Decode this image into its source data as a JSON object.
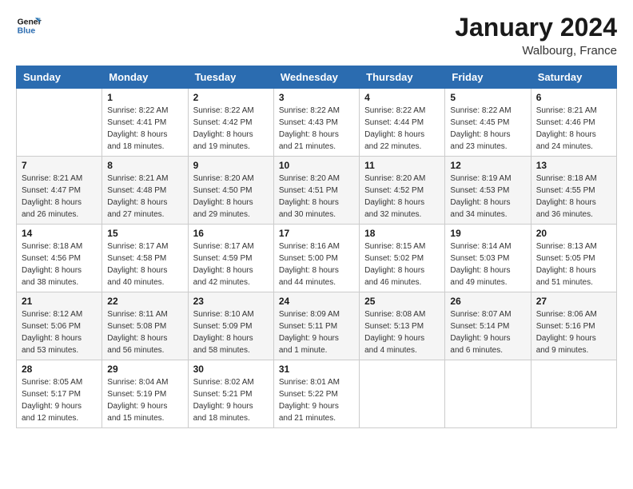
{
  "logo": {
    "line1": "General",
    "line2": "Blue",
    "icon_color": "#2b6cb0"
  },
  "title": "January 2024",
  "location": "Walbourg, France",
  "days_of_week": [
    "Sunday",
    "Monday",
    "Tuesday",
    "Wednesday",
    "Thursday",
    "Friday",
    "Saturday"
  ],
  "weeks": [
    [
      {
        "day": "",
        "sunrise": "",
        "sunset": "",
        "daylight": ""
      },
      {
        "day": "1",
        "sunrise": "Sunrise: 8:22 AM",
        "sunset": "Sunset: 4:41 PM",
        "daylight": "Daylight: 8 hours and 18 minutes."
      },
      {
        "day": "2",
        "sunrise": "Sunrise: 8:22 AM",
        "sunset": "Sunset: 4:42 PM",
        "daylight": "Daylight: 8 hours and 19 minutes."
      },
      {
        "day": "3",
        "sunrise": "Sunrise: 8:22 AM",
        "sunset": "Sunset: 4:43 PM",
        "daylight": "Daylight: 8 hours and 21 minutes."
      },
      {
        "day": "4",
        "sunrise": "Sunrise: 8:22 AM",
        "sunset": "Sunset: 4:44 PM",
        "daylight": "Daylight: 8 hours and 22 minutes."
      },
      {
        "day": "5",
        "sunrise": "Sunrise: 8:22 AM",
        "sunset": "Sunset: 4:45 PM",
        "daylight": "Daylight: 8 hours and 23 minutes."
      },
      {
        "day": "6",
        "sunrise": "Sunrise: 8:21 AM",
        "sunset": "Sunset: 4:46 PM",
        "daylight": "Daylight: 8 hours and 24 minutes."
      }
    ],
    [
      {
        "day": "7",
        "sunrise": "Sunrise: 8:21 AM",
        "sunset": "Sunset: 4:47 PM",
        "daylight": "Daylight: 8 hours and 26 minutes."
      },
      {
        "day": "8",
        "sunrise": "Sunrise: 8:21 AM",
        "sunset": "Sunset: 4:48 PM",
        "daylight": "Daylight: 8 hours and 27 minutes."
      },
      {
        "day": "9",
        "sunrise": "Sunrise: 8:20 AM",
        "sunset": "Sunset: 4:50 PM",
        "daylight": "Daylight: 8 hours and 29 minutes."
      },
      {
        "day": "10",
        "sunrise": "Sunrise: 8:20 AM",
        "sunset": "Sunset: 4:51 PM",
        "daylight": "Daylight: 8 hours and 30 minutes."
      },
      {
        "day": "11",
        "sunrise": "Sunrise: 8:20 AM",
        "sunset": "Sunset: 4:52 PM",
        "daylight": "Daylight: 8 hours and 32 minutes."
      },
      {
        "day": "12",
        "sunrise": "Sunrise: 8:19 AM",
        "sunset": "Sunset: 4:53 PM",
        "daylight": "Daylight: 8 hours and 34 minutes."
      },
      {
        "day": "13",
        "sunrise": "Sunrise: 8:18 AM",
        "sunset": "Sunset: 4:55 PM",
        "daylight": "Daylight: 8 hours and 36 minutes."
      }
    ],
    [
      {
        "day": "14",
        "sunrise": "Sunrise: 8:18 AM",
        "sunset": "Sunset: 4:56 PM",
        "daylight": "Daylight: 8 hours and 38 minutes."
      },
      {
        "day": "15",
        "sunrise": "Sunrise: 8:17 AM",
        "sunset": "Sunset: 4:58 PM",
        "daylight": "Daylight: 8 hours and 40 minutes."
      },
      {
        "day": "16",
        "sunrise": "Sunrise: 8:17 AM",
        "sunset": "Sunset: 4:59 PM",
        "daylight": "Daylight: 8 hours and 42 minutes."
      },
      {
        "day": "17",
        "sunrise": "Sunrise: 8:16 AM",
        "sunset": "Sunset: 5:00 PM",
        "daylight": "Daylight: 8 hours and 44 minutes."
      },
      {
        "day": "18",
        "sunrise": "Sunrise: 8:15 AM",
        "sunset": "Sunset: 5:02 PM",
        "daylight": "Daylight: 8 hours and 46 minutes."
      },
      {
        "day": "19",
        "sunrise": "Sunrise: 8:14 AM",
        "sunset": "Sunset: 5:03 PM",
        "daylight": "Daylight: 8 hours and 49 minutes."
      },
      {
        "day": "20",
        "sunrise": "Sunrise: 8:13 AM",
        "sunset": "Sunset: 5:05 PM",
        "daylight": "Daylight: 8 hours and 51 minutes."
      }
    ],
    [
      {
        "day": "21",
        "sunrise": "Sunrise: 8:12 AM",
        "sunset": "Sunset: 5:06 PM",
        "daylight": "Daylight: 8 hours and 53 minutes."
      },
      {
        "day": "22",
        "sunrise": "Sunrise: 8:11 AM",
        "sunset": "Sunset: 5:08 PM",
        "daylight": "Daylight: 8 hours and 56 minutes."
      },
      {
        "day": "23",
        "sunrise": "Sunrise: 8:10 AM",
        "sunset": "Sunset: 5:09 PM",
        "daylight": "Daylight: 8 hours and 58 minutes."
      },
      {
        "day": "24",
        "sunrise": "Sunrise: 8:09 AM",
        "sunset": "Sunset: 5:11 PM",
        "daylight": "Daylight: 9 hours and 1 minute."
      },
      {
        "day": "25",
        "sunrise": "Sunrise: 8:08 AM",
        "sunset": "Sunset: 5:13 PM",
        "daylight": "Daylight: 9 hours and 4 minutes."
      },
      {
        "day": "26",
        "sunrise": "Sunrise: 8:07 AM",
        "sunset": "Sunset: 5:14 PM",
        "daylight": "Daylight: 9 hours and 6 minutes."
      },
      {
        "day": "27",
        "sunrise": "Sunrise: 8:06 AM",
        "sunset": "Sunset: 5:16 PM",
        "daylight": "Daylight: 9 hours and 9 minutes."
      }
    ],
    [
      {
        "day": "28",
        "sunrise": "Sunrise: 8:05 AM",
        "sunset": "Sunset: 5:17 PM",
        "daylight": "Daylight: 9 hours and 12 minutes."
      },
      {
        "day": "29",
        "sunrise": "Sunrise: 8:04 AM",
        "sunset": "Sunset: 5:19 PM",
        "daylight": "Daylight: 9 hours and 15 minutes."
      },
      {
        "day": "30",
        "sunrise": "Sunrise: 8:02 AM",
        "sunset": "Sunset: 5:21 PM",
        "daylight": "Daylight: 9 hours and 18 minutes."
      },
      {
        "day": "31",
        "sunrise": "Sunrise: 8:01 AM",
        "sunset": "Sunset: 5:22 PM",
        "daylight": "Daylight: 9 hours and 21 minutes."
      },
      {
        "day": "",
        "sunrise": "",
        "sunset": "",
        "daylight": ""
      },
      {
        "day": "",
        "sunrise": "",
        "sunset": "",
        "daylight": ""
      },
      {
        "day": "",
        "sunrise": "",
        "sunset": "",
        "daylight": ""
      }
    ]
  ]
}
